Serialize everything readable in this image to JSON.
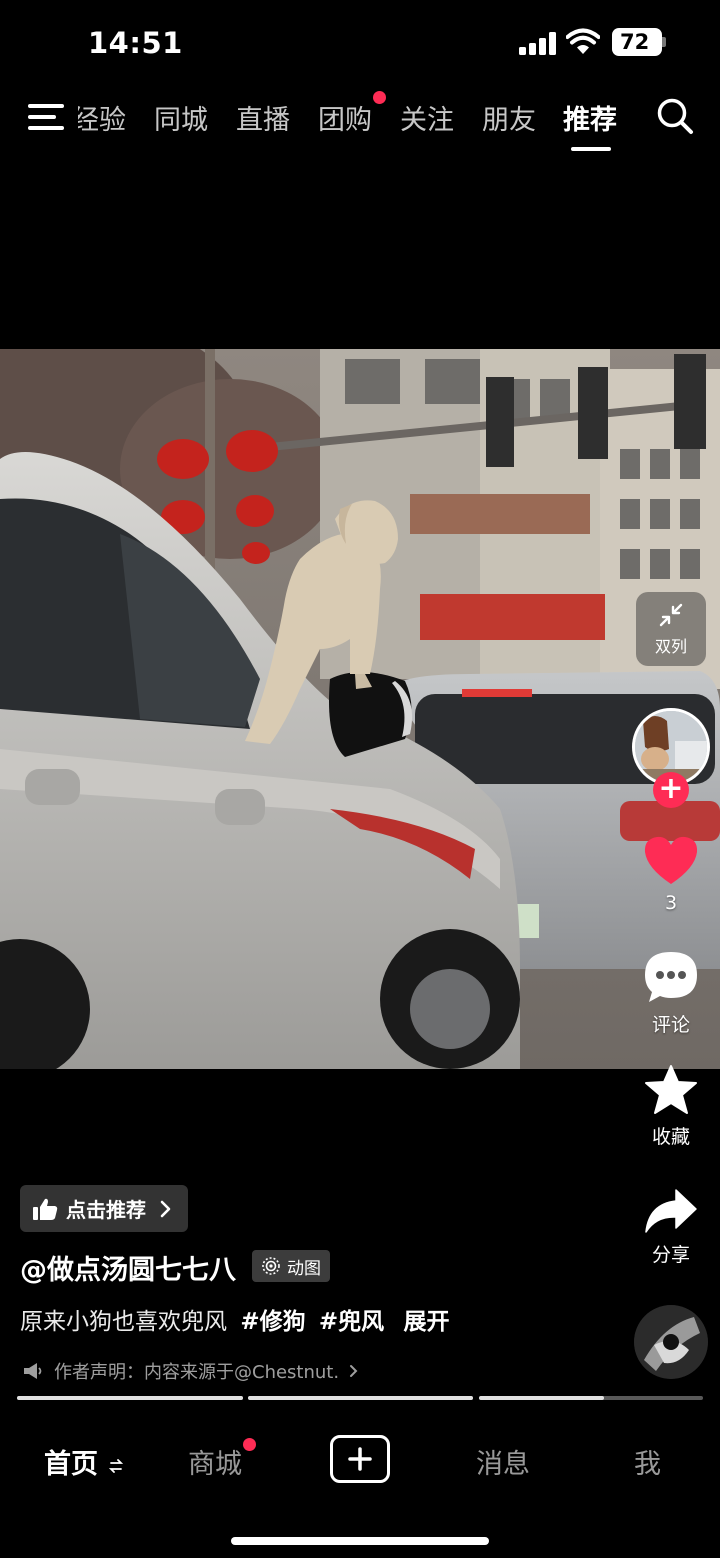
{
  "status_bar": {
    "time": "14:51",
    "battery": "72"
  },
  "top_nav": {
    "tabs": [
      {
        "label": "经验"
      },
      {
        "label": "同城"
      },
      {
        "label": "直播"
      },
      {
        "label": "团购"
      },
      {
        "label": "关注"
      },
      {
        "label": "朋友"
      },
      {
        "label": "推荐"
      }
    ],
    "active_tab": "推荐",
    "badge_tab": "团购"
  },
  "video": {
    "double_column_label": "双列",
    "subject": "dog standing on car side mirror"
  },
  "actions": {
    "like_count": "3",
    "comment_label": "评论",
    "favorite_label": "收藏",
    "share_label": "分享"
  },
  "info": {
    "recommend_label": "点击推荐",
    "author": "@做点汤圆七七八",
    "motion_tag": "动图",
    "caption_text": "原来小狗也喜欢兜风",
    "hashtags": [
      "#修狗",
      "#兜风"
    ],
    "expand_label": "展开",
    "declaration": "作者声明：内容来源于@Chestnut."
  },
  "progress_segments": [
    1.0,
    1.0,
    0.56
  ],
  "tab_bar": {
    "home": "首页",
    "mall": "商城",
    "messages": "消息",
    "me": "我"
  },
  "colors": {
    "accent": "#fe2c55",
    "background": "#000000"
  }
}
